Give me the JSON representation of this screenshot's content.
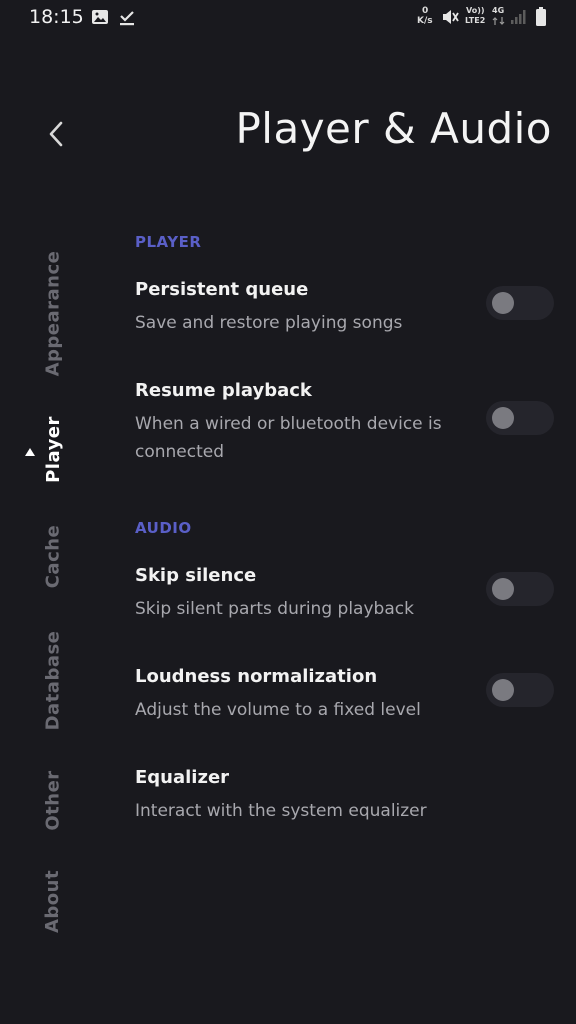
{
  "status_bar": {
    "time": "18:15",
    "net_speed_value": "0",
    "net_speed_unit": "K/s",
    "volte_top": "Vo))",
    "volte_bottom": "LTE2",
    "network_type": "4G",
    "icons": [
      "image-icon",
      "download-done-icon",
      "vibrate-icon",
      "signal-icon",
      "battery-icon"
    ]
  },
  "header": {
    "title": "Player & Audio",
    "back_icon": "chevron-left-icon"
  },
  "nav": {
    "items": [
      {
        "label": "Appearance",
        "active": false
      },
      {
        "label": "Player",
        "active": true
      },
      {
        "label": "Cache",
        "active": false
      },
      {
        "label": "Database",
        "active": false
      },
      {
        "label": "Other",
        "active": false
      },
      {
        "label": "About",
        "active": false
      }
    ]
  },
  "sections": {
    "player": {
      "header": "PLAYER",
      "items": [
        {
          "title": "Persistent queue",
          "description": "Save and restore playing songs",
          "enabled": false
        },
        {
          "title": "Resume playback",
          "description": "When a wired or bluetooth device is connected",
          "enabled": false
        }
      ]
    },
    "audio": {
      "header": "AUDIO",
      "items": [
        {
          "title": "Skip silence",
          "description": "Skip silent parts during playback",
          "enabled": false
        },
        {
          "title": "Loudness normalization",
          "description": "Adjust the volume to a fixed level",
          "enabled": false
        },
        {
          "title": "Equalizer",
          "description": "Interact with the system equalizer"
        }
      ]
    }
  },
  "colors": {
    "background": "#19191e",
    "accent": "#5a5fc7",
    "text_primary": "#f2f2f2",
    "text_secondary": "#a8a8ae",
    "nav_inactive": "#6a6a72",
    "toggle_track": "#25252c",
    "toggle_knob": "#7a7a80"
  }
}
